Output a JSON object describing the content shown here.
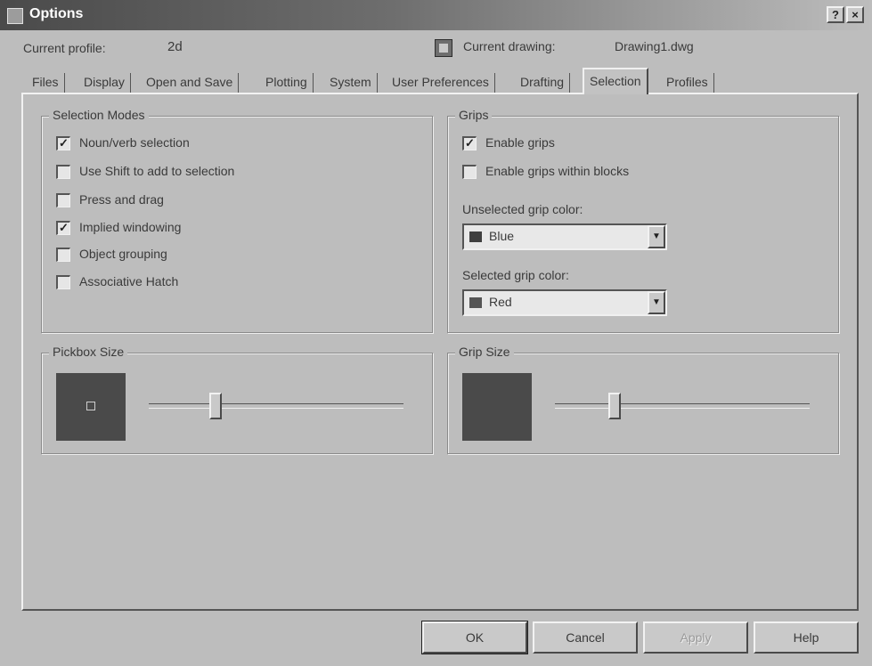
{
  "window": {
    "title": "Options",
    "help_label": "?",
    "close_label": "×"
  },
  "profile": {
    "label": "Current profile:",
    "value": "2d"
  },
  "drawing": {
    "label": "Current drawing:",
    "value": "Drawing1.dwg"
  },
  "tabs": [
    {
      "label": "Files"
    },
    {
      "label": "Display"
    },
    {
      "label": "Open and Save"
    },
    {
      "label": "Plotting"
    },
    {
      "label": "System"
    },
    {
      "label": "User Preferences"
    },
    {
      "label": "Drafting"
    },
    {
      "label": "Selection",
      "active": true
    },
    {
      "label": "Profiles"
    }
  ],
  "selection_modes": {
    "title": "Selection Modes",
    "items": [
      {
        "label": "Noun/verb selection",
        "checked": true
      },
      {
        "label": "Use Shift to add to selection",
        "checked": false
      },
      {
        "label": "Press and drag",
        "checked": false
      },
      {
        "label": "Implied windowing",
        "checked": true
      },
      {
        "label": "Object grouping",
        "checked": false
      },
      {
        "label": "Associative Hatch",
        "checked": false
      }
    ]
  },
  "grips": {
    "title": "Grips",
    "items": [
      {
        "label": "Enable grips",
        "checked": true
      },
      {
        "label": "Enable grips within blocks",
        "checked": false
      }
    ],
    "unselected_color": {
      "label": "Unselected grip color:",
      "value": "Blue",
      "swatch": "#3f3f3f"
    },
    "selected_color": {
      "label": "Selected grip color:",
      "value": "Red",
      "swatch": "#555555"
    }
  },
  "pickbox": {
    "title": "Pickbox Size",
    "level": 0.25
  },
  "gripsize": {
    "title": "Grip Size",
    "level": 0.22
  },
  "buttons": {
    "ok": "OK",
    "cancel": "Cancel",
    "apply": "Apply",
    "help": "Help"
  },
  "colors": {
    "face": "#bdbdbd",
    "titlebar": "#4a4a4a",
    "preview": "#4a4a4a"
  }
}
